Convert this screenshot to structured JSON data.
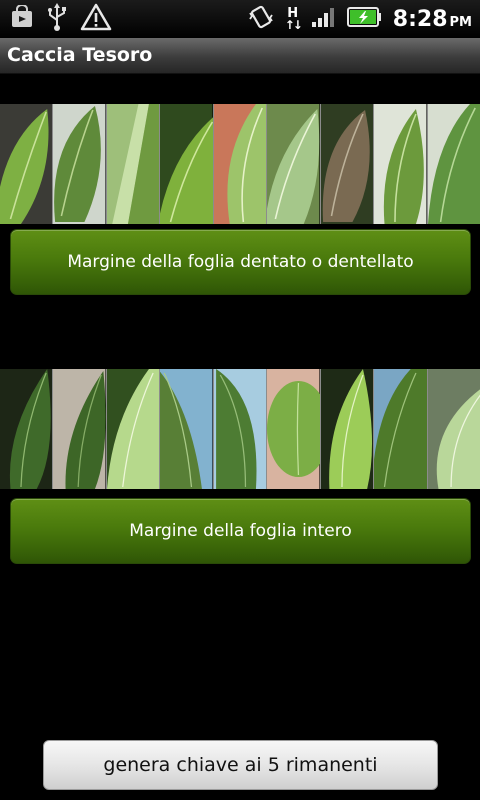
{
  "status_bar": {
    "time": "8:28",
    "ampm": "PM",
    "network_type": "H",
    "left_icons": [
      "shopping-bag-icon",
      "usb-icon",
      "warning-icon"
    ],
    "right_icons": [
      "vibrate-icon",
      "network-h-icon",
      "signal-icon",
      "battery-charging-icon"
    ]
  },
  "title_bar": {
    "title": "Caccia Tesoro"
  },
  "options": [
    {
      "label": "Margine della foglia dentato o dentellato",
      "image": "toothed-leaf-margins-strip"
    },
    {
      "label": "Margine della foglia intero",
      "image": "entire-leaf-margins-strip"
    }
  ],
  "bottom_button": {
    "label": "genera chiave ai 5 rimanenti"
  },
  "colors": {
    "button_green": "#4a7a0c",
    "title_bar": "#3c3c3c",
    "background": "#000000"
  }
}
